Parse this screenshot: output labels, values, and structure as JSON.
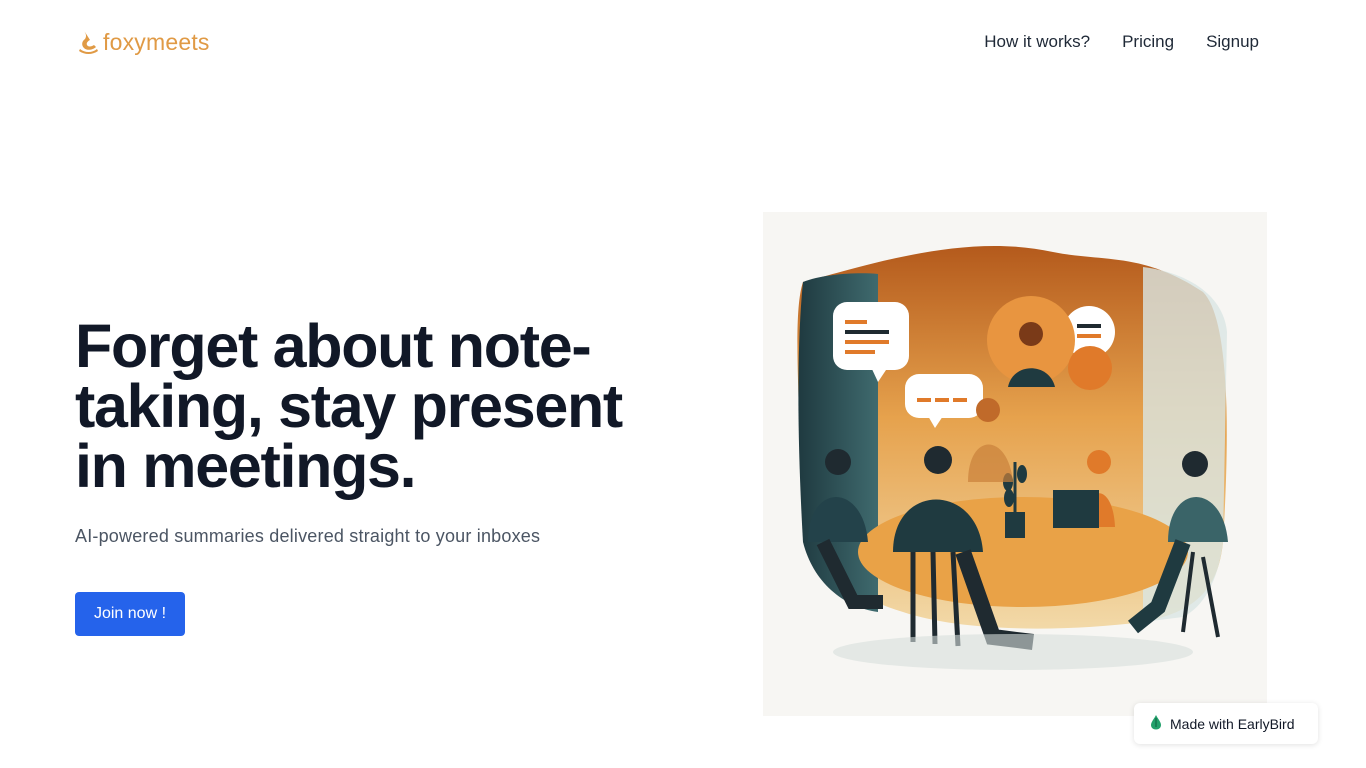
{
  "header": {
    "logo_text": "foxymeets",
    "nav": [
      {
        "label": "How it works?"
      },
      {
        "label": "Pricing"
      },
      {
        "label": "Signup"
      }
    ]
  },
  "hero": {
    "title": "Forget about note-taking, stay present in meetings.",
    "subtitle": "AI-powered summaries delivered straight to your inboxes",
    "cta_label": "Join now !"
  },
  "illustration": {
    "subject": "meeting-illustration"
  },
  "badge": {
    "label": "Made with EarlyBird",
    "icon": "earlybird-drop-icon"
  },
  "colors": {
    "brand": "#e09a45",
    "primary": "#2563eb",
    "heading": "#111827"
  }
}
